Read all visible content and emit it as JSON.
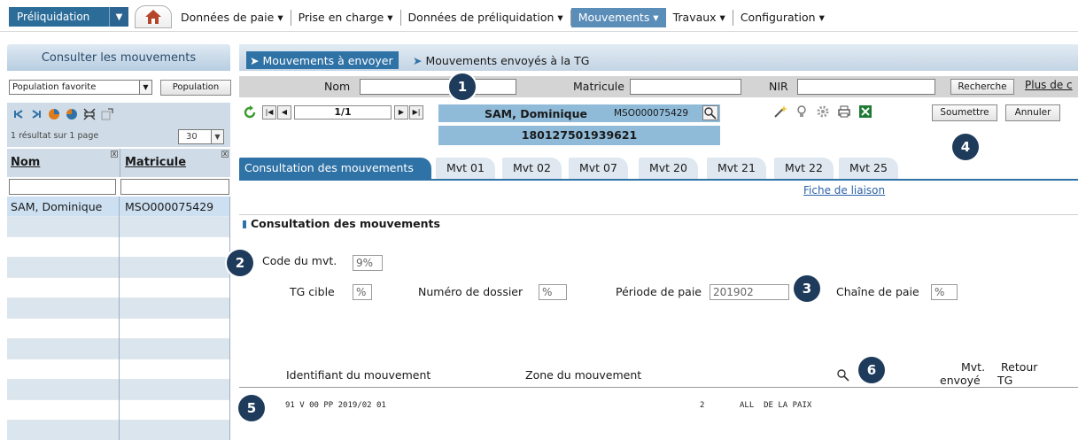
{
  "topbar": {
    "app_button": "Préliquidation",
    "menu": [
      "Données de paie ▾",
      "Prise en charge ▾",
      "Données de préliquidation ▾",
      "Mouvements ▾",
      "Travaux ▾",
      "Configuration ▾"
    ]
  },
  "left": {
    "title": "Consulter les mouvements",
    "population_select": "Population favorite",
    "population_button": "Population",
    "result_info": "1 résultat sur 1 page",
    "page_size": "30",
    "col_nom": "Nom",
    "col_matricule": "Matricule",
    "rows": [
      {
        "nom": "SAM, Dominique",
        "matricule": "MSO000075429"
      }
    ]
  },
  "main": {
    "subtabs": {
      "active": "Mouvements à envoyer",
      "other": "Mouvements envoyés à la TG"
    },
    "search": {
      "nom_label": "Nom",
      "matricule_label": "Matricule",
      "nir_label": "NIR",
      "recherche_button": "Recherche",
      "more_link": "Plus de c"
    },
    "nav": {
      "page": "1/1"
    },
    "identity": {
      "name": "SAM, Dominique",
      "matricule": "MSO000075429",
      "nir": "180127501939621"
    },
    "actions": {
      "submit": "Soumettre",
      "cancel": "Annuler"
    },
    "tabs": [
      "Consultation des mouvements",
      "Mvt 01",
      "Mvt 02",
      "Mvt 07",
      "Mvt 20",
      "Mvt 21",
      "Mvt 22",
      "Mvt 25"
    ],
    "fiche_link": "Fiche de liaison",
    "section_title": "Consultation des mouvements",
    "form": {
      "code_label": "Code du mvt.",
      "code_value": "9%",
      "tg_label": "TG cible",
      "tg_value": "%",
      "dossier_label": "Numéro de dossier",
      "dossier_value": "%",
      "periode_label": "Période de paie",
      "periode_value": "201902",
      "chaine_label": "Chaîne de paie",
      "chaine_value": "%"
    },
    "results": {
      "col_identifiant": "Identifiant du mouvement",
      "col_zone": "Zone du mouvement",
      "col_mvt": "Mvt.",
      "col_envoye": "envoyé",
      "col_retour": "Retour",
      "col_tg": "TG",
      "row_identifiant": "91 V 00 PP 2019/02 01",
      "row_number": "2",
      "row_zone": "ALL  DE LA PAIX"
    }
  },
  "callouts": [
    "1",
    "2",
    "3",
    "4",
    "5",
    "6"
  ],
  "colors": {
    "accent": "#2f72a6",
    "id_box": "#8fbbd9",
    "callout": "#1f3b5c"
  }
}
